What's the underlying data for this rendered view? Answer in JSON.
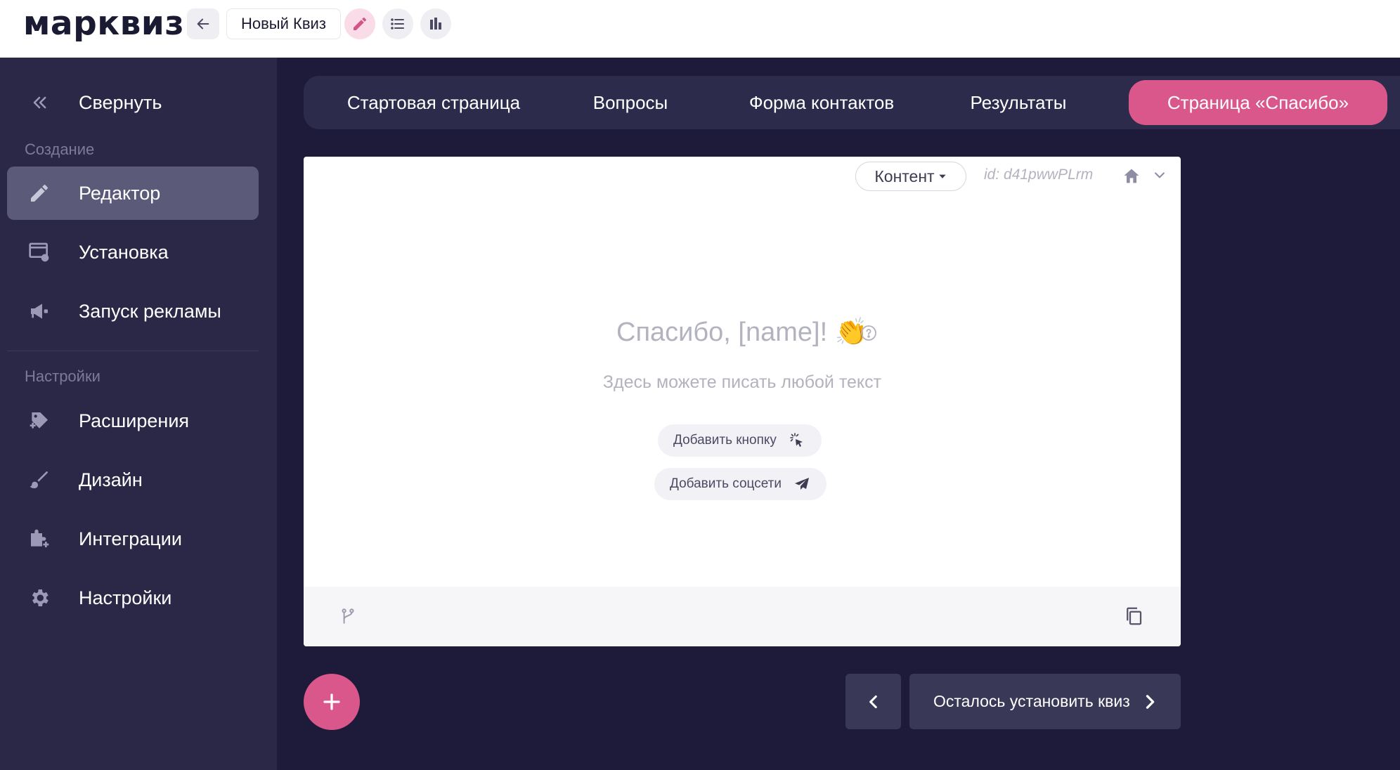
{
  "app": {
    "logo": "марквиз"
  },
  "topbar": {
    "quiz_name": "Новый Квиз"
  },
  "sidebar": {
    "collapse_label": "Свернуть",
    "section_create": "Создание",
    "section_settings": "Настройки",
    "items": [
      {
        "label": "Редактор",
        "icon": "pencil-icon",
        "active": true
      },
      {
        "label": "Установка",
        "icon": "install-icon"
      },
      {
        "label": "Запуск рекламы",
        "icon": "megaphone-icon"
      },
      {
        "label": "Расширения",
        "icon": "extensions-icon"
      },
      {
        "label": "Дизайн",
        "icon": "brush-icon"
      },
      {
        "label": "Интеграции",
        "icon": "integrations-icon"
      },
      {
        "label": "Настройки",
        "icon": "gear-icon"
      }
    ]
  },
  "tabs": [
    {
      "label": "Стартовая страница"
    },
    {
      "label": "Вопросы"
    },
    {
      "label": "Форма контактов"
    },
    {
      "label": "Результаты"
    },
    {
      "label": "Страница «Спасибо»",
      "active": true
    }
  ],
  "card": {
    "content_dropdown": "Контент",
    "id_text": "id: d41pwwPLrm",
    "title": "Спасибо, [name]! 👏",
    "subtitle": "Здесь можете писать любой текст",
    "add_button_label": "Добавить кнопку",
    "add_social_label": "Добавить соцсети"
  },
  "footer_nav": {
    "next_label": "Осталось установить квиз"
  },
  "colors": {
    "accent": "#d9578a",
    "sidebar_bg": "#2a2846",
    "main_bg": "#1e1b3a"
  }
}
